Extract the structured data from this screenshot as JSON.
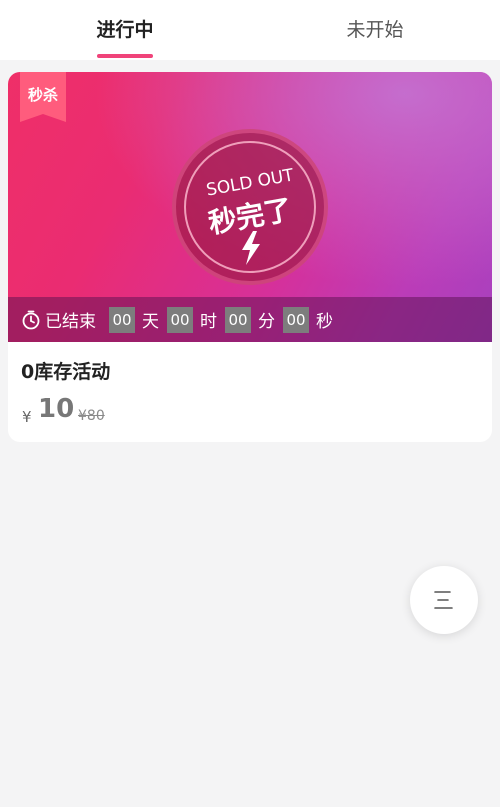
{
  "tabs": [
    {
      "label": "进行中",
      "active": true
    },
    {
      "label": "未开始",
      "active": false
    }
  ],
  "card": {
    "ribbon_label": "秒杀",
    "sold_out": {
      "en": "SOLD OUT",
      "cn": "秒完了"
    },
    "countdown": {
      "status": "已结束",
      "days": "00",
      "days_unit": "天",
      "hours": "00",
      "hours_unit": "时",
      "minutes": "00",
      "minutes_unit": "分",
      "seconds": "00",
      "seconds_unit": "秒"
    },
    "title": "0库存活动",
    "price": {
      "currency": "¥",
      "value": "10",
      "original": "¥80"
    }
  },
  "fab": {
    "icon": "menu-icon"
  },
  "colors": {
    "accent": "#f0437a",
    "ribbon": "#ff5c7d"
  }
}
